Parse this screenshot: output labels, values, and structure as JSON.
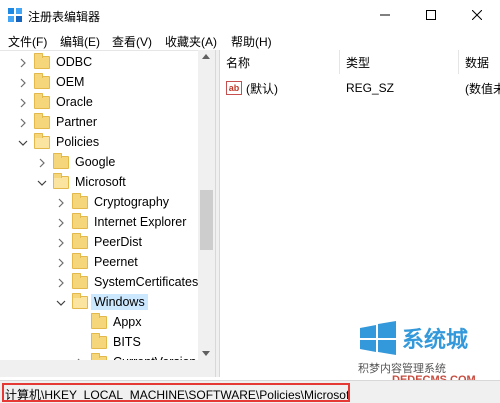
{
  "window": {
    "title": "注册表编辑器"
  },
  "menu": [
    "文件(F)",
    "编辑(E)",
    "查看(V)",
    "收藏夹(A)",
    "帮助(H)"
  ],
  "tree": [
    {
      "label": "ODBC",
      "indent": 0,
      "chevron": "right"
    },
    {
      "label": "OEM",
      "indent": 0,
      "chevron": "right"
    },
    {
      "label": "Oracle",
      "indent": 0,
      "chevron": "right"
    },
    {
      "label": "Partner",
      "indent": 0,
      "chevron": "right"
    },
    {
      "label": "Policies",
      "indent": 0,
      "chevron": "down"
    },
    {
      "label": "Google",
      "indent": 1,
      "chevron": "right"
    },
    {
      "label": "Microsoft",
      "indent": 1,
      "chevron": "down"
    },
    {
      "label": "Cryptography",
      "indent": 2,
      "chevron": "right"
    },
    {
      "label": "Internet Explorer",
      "indent": 2,
      "chevron": "right"
    },
    {
      "label": "PeerDist",
      "indent": 2,
      "chevron": "right"
    },
    {
      "label": "Peernet",
      "indent": 2,
      "chevron": "right"
    },
    {
      "label": "SystemCertificates",
      "indent": 2,
      "chevron": "right"
    },
    {
      "label": "Windows",
      "indent": 2,
      "chevron": "down",
      "selected": true
    },
    {
      "label": "Appx",
      "indent": 3,
      "chevron": "none"
    },
    {
      "label": "BITS",
      "indent": 3,
      "chevron": "none"
    },
    {
      "label": "CurrentVersion",
      "indent": 3,
      "chevron": "right"
    }
  ],
  "columns": {
    "name": "名称",
    "type": "类型",
    "data": "数据"
  },
  "rows": [
    {
      "name": "(默认)",
      "type": "REG_SZ",
      "data": "(数值未"
    }
  ],
  "status": {
    "path": "计算机\\HKEY_LOCAL_MACHINE\\SOFTWARE\\Policies\\Microsoft\\Windows"
  },
  "watermark": {
    "brand": "系统城",
    "tagline": "积梦内容管理系统",
    "url": "DEDECMS.COM"
  },
  "colors": {
    "selection": "#cce8ff",
    "highlight_border": "#e53935",
    "folder": "#f6d67a"
  }
}
